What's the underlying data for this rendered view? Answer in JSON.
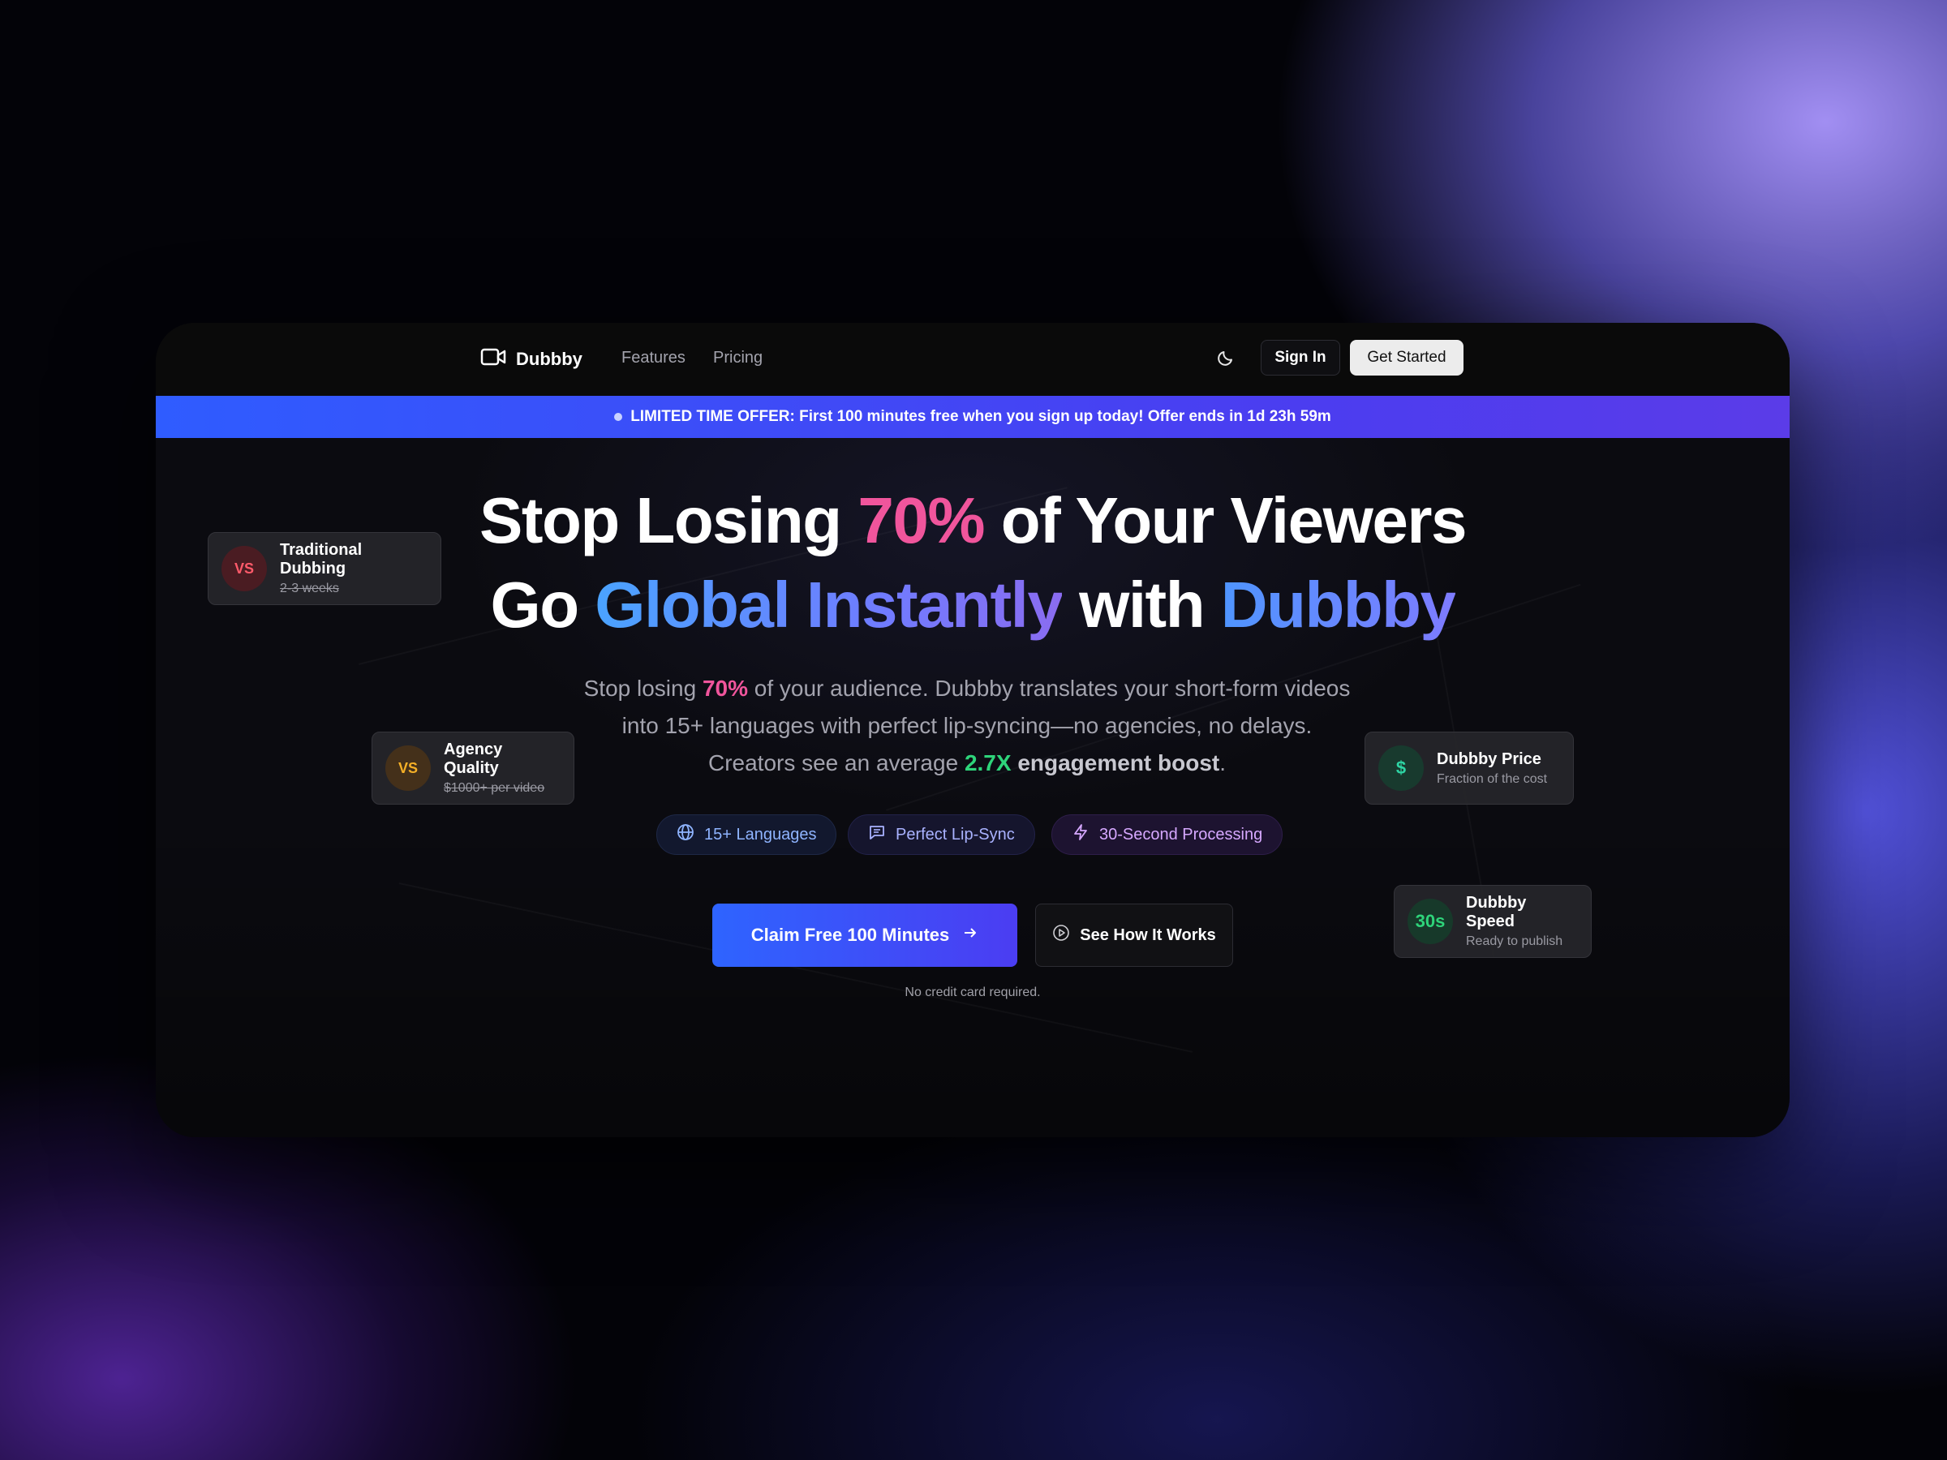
{
  "nav": {
    "brand": "Dubbby",
    "links": [
      "Features",
      "Pricing"
    ],
    "sign_in": "Sign In",
    "get_started": "Get Started",
    "theme_icon": "moon-icon",
    "brand_icon": "video-camera-icon"
  },
  "banner": {
    "text": "LIMITED TIME OFFER: First 100 minutes free when you sign up today! Offer ends in 1d 23h 59m"
  },
  "hero": {
    "line1": {
      "a": "Stop Losing ",
      "b": "70%",
      "c": " of Your Viewers"
    },
    "line2": {
      "a": "Go ",
      "b": "Global Instantly",
      "c": " with ",
      "d": "Dubbby"
    },
    "subtitle": {
      "a": "Stop losing ",
      "b": "70%",
      "c": " of your audience. Dubbby translates your short-form videos into 15+ languages with perfect lip-syncing—no agencies, no delays. Creators see an average ",
      "d": "2.7X",
      "e": " engagement boost",
      "f": "."
    }
  },
  "pills": [
    {
      "label": "15+ Languages",
      "icon": "globe-icon"
    },
    {
      "label": "Perfect Lip-Sync",
      "icon": "chat-icon"
    },
    {
      "label": "30-Second Processing",
      "icon": "lightning-icon"
    }
  ],
  "cta": {
    "primary": "Claim Free 100 Minutes",
    "secondary": "See How It Works",
    "note": "No credit card required."
  },
  "cards": {
    "traditional": {
      "badge": "VS",
      "title": "Traditional Dubbing",
      "sub": "2-3 weeks"
    },
    "agency": {
      "badge": "VS",
      "title": "Agency Quality",
      "sub": "$1000+ per video"
    },
    "price": {
      "badge": "$",
      "title": "Dubbby Price",
      "sub": "Fraction of the cost"
    },
    "speed": {
      "badge": "30s",
      "title": "Dubbby Speed",
      "sub": "Ready to publish"
    }
  },
  "colors": {
    "accent_pink": "#f0559c",
    "accent_green": "#2ed47a",
    "accent_blue": "#2e64ff",
    "accent_indigo": "#4b3df2"
  }
}
